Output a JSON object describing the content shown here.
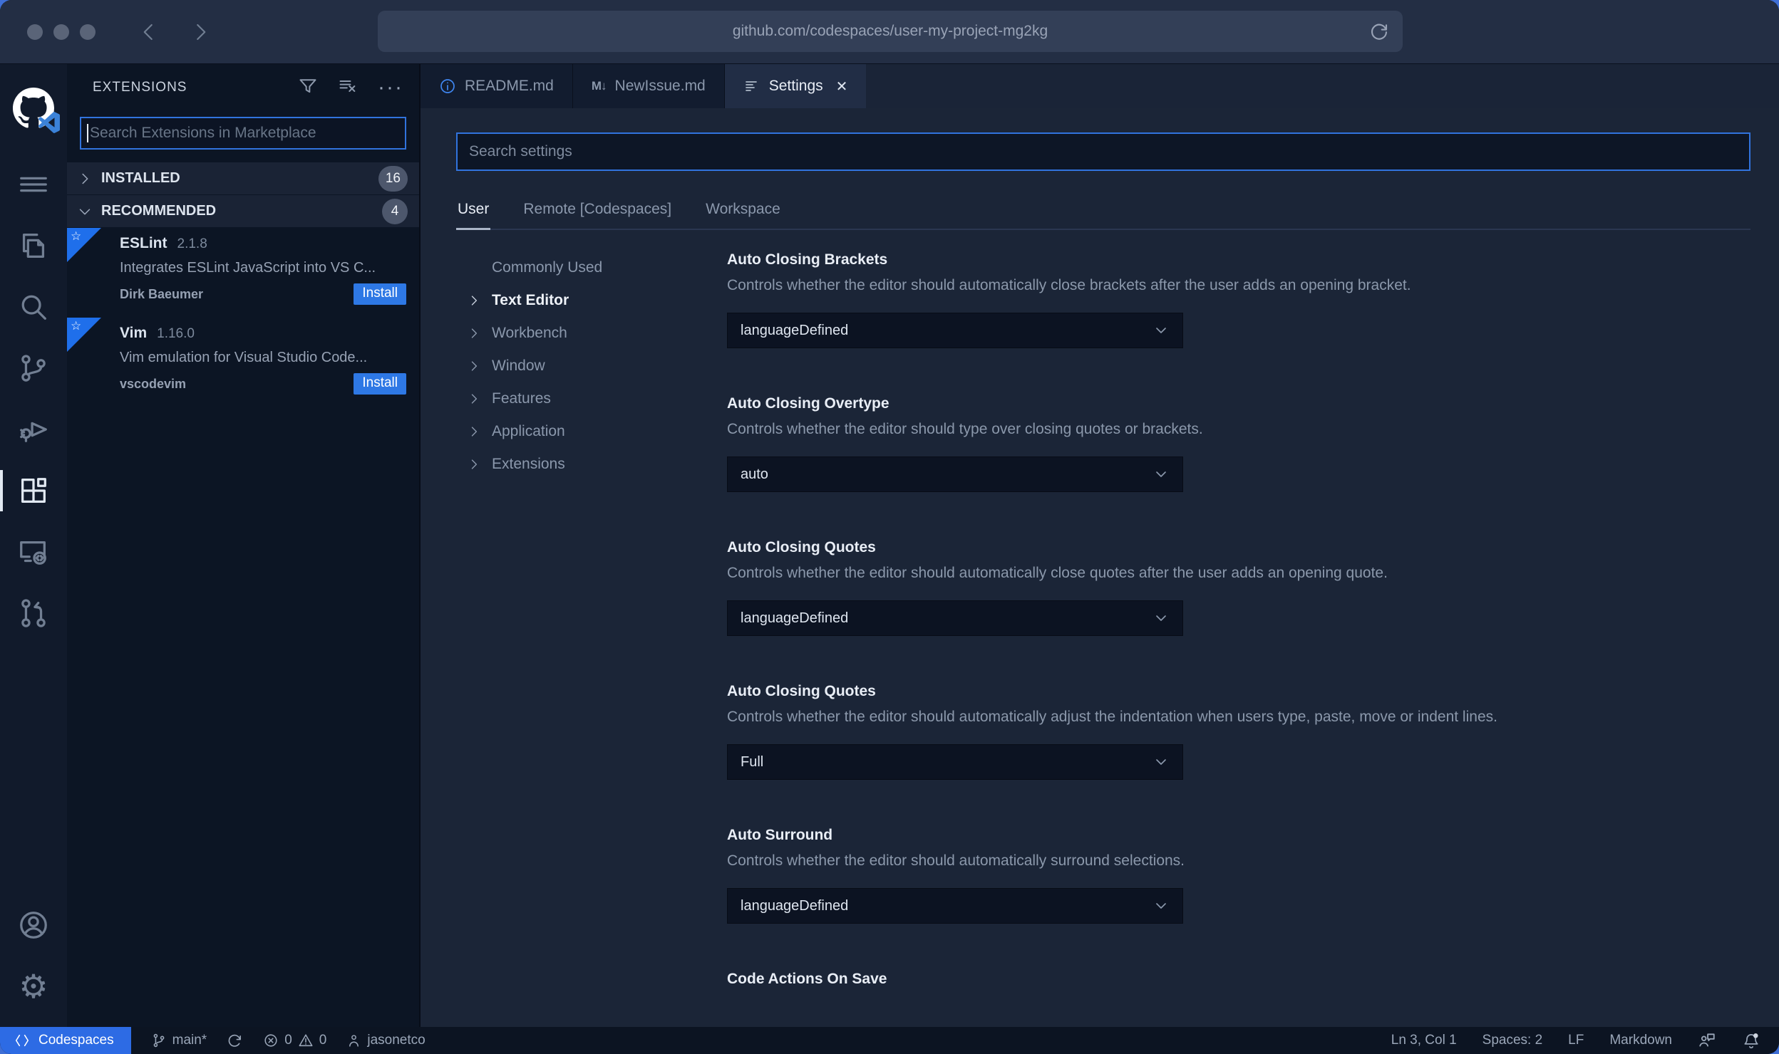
{
  "browser": {
    "url": "github.com/codespaces/user-my-project-mg2kg"
  },
  "colors": {
    "desktop": "#3f6fd6",
    "focus_border": "#3173dd",
    "install_button": "#2e78e5",
    "ribbon": "#1f6feb",
    "codespaces_chip": "#2d6be4"
  },
  "activity_bar": {
    "items": [
      {
        "icon": "github-logo"
      },
      {
        "icon": "menu-icon"
      },
      {
        "icon": "explorer-icon"
      },
      {
        "icon": "search-icon"
      },
      {
        "icon": "source-control-icon"
      },
      {
        "icon": "run-debug-icon"
      },
      {
        "icon": "extensions-icon",
        "active": true
      },
      {
        "icon": "remote-explorer-icon"
      },
      {
        "icon": "pull-request-icon"
      },
      {
        "icon": "account-icon"
      },
      {
        "icon": "settings-gear-icon"
      }
    ],
    "gear_glyph": "⚙"
  },
  "sidebar": {
    "title": "EXTENSIONS",
    "more_dots": "···",
    "search_placeholder": "Search Extensions in Marketplace",
    "sections": [
      {
        "label": "INSTALLED",
        "count": "16"
      },
      {
        "label": "RECOMMENDED",
        "count": "4"
      }
    ],
    "ribbon_star": "☆",
    "extensions": [
      {
        "name": "ESLint",
        "version": "2.1.8",
        "description": "Integrates ESLint JavaScript into VS C...",
        "publisher": "Dirk Baeumer",
        "action": "Install"
      },
      {
        "name": "Vim",
        "version": "1.16.0",
        "description": "Vim emulation for Visual Studio Code...",
        "publisher": "vscodevim",
        "action": "Install"
      }
    ]
  },
  "tabs": [
    {
      "label": "README.md"
    },
    {
      "label": "NewIssue.md",
      "icon_text": "M↓"
    },
    {
      "label": "Settings",
      "close": "✕"
    }
  ],
  "settings": {
    "search_placeholder": "Search settings",
    "scopes": [
      {
        "label": "User",
        "active": true
      },
      {
        "label": "Remote [Codespaces]"
      },
      {
        "label": "Workspace"
      }
    ],
    "toc": [
      {
        "label": "Commonly Used"
      },
      {
        "label": "Text Editor",
        "active": true
      },
      {
        "label": "Workbench"
      },
      {
        "label": "Window"
      },
      {
        "label": "Features"
      },
      {
        "label": "Application"
      },
      {
        "label": "Extensions"
      }
    ],
    "items": [
      {
        "title": "Auto Closing Brackets",
        "description": "Controls whether the editor should automatically close brackets after the user adds an opening bracket.",
        "value": "languageDefined"
      },
      {
        "title": "Auto Closing Overtype",
        "description": "Controls whether the editor should type over closing quotes or brackets.",
        "value": "auto"
      },
      {
        "title": "Auto Closing Quotes",
        "description": "Controls whether the editor should automatically close quotes after the user adds an opening quote.",
        "value": "languageDefined"
      },
      {
        "title": "Auto Closing Quotes",
        "description": "Controls whether the editor should automatically adjust the indentation when users type, paste, move or indent lines.",
        "value": "Full"
      },
      {
        "title": "Auto Surround",
        "description": "Controls whether the editor should automatically surround selections.",
        "value": "languageDefined"
      },
      {
        "title": "Code Actions On Save"
      }
    ]
  },
  "status_bar": {
    "codespaces": "Codespaces",
    "branch": "main*",
    "errors": "0",
    "warnings": "0",
    "user": "jasonetco",
    "line_col": "Ln 3, Col 1",
    "spaces": "Spaces: 2",
    "eol": "LF",
    "language": "Markdown"
  }
}
